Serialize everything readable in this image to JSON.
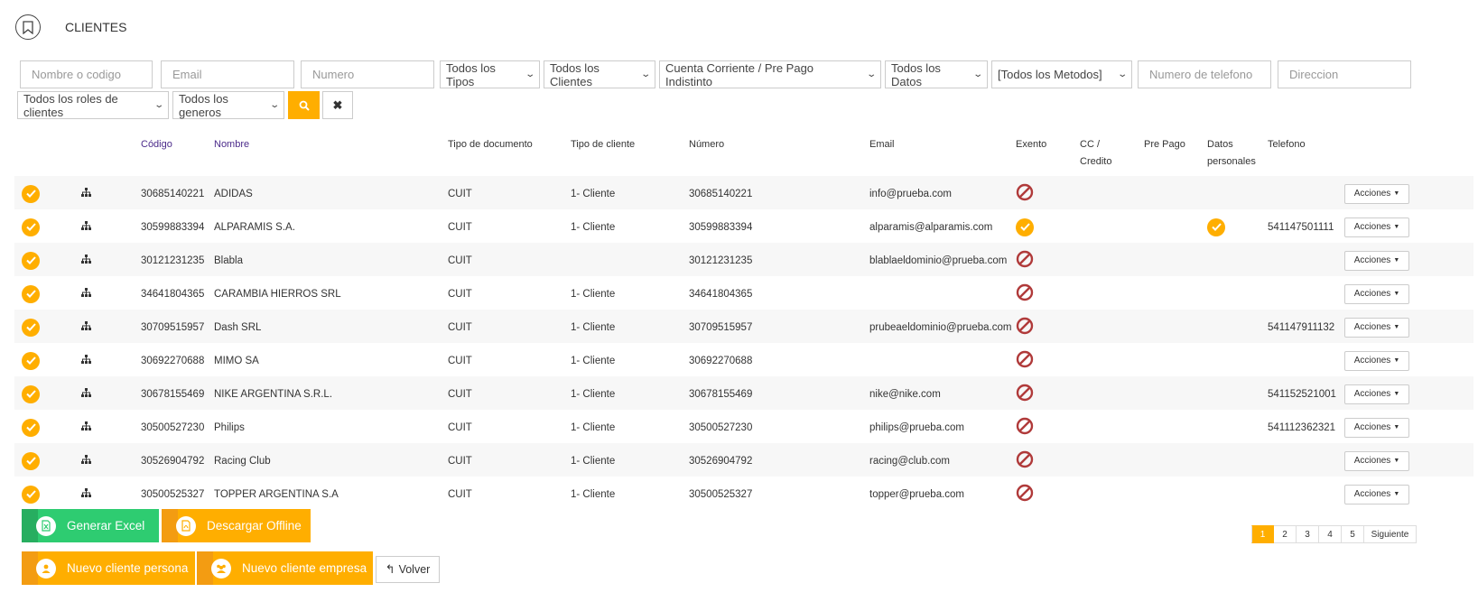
{
  "header": {
    "title": "CLIENTES"
  },
  "filters": {
    "name_placeholder": "Nombre o codigo",
    "email_placeholder": "Email",
    "number_placeholder": "Numero",
    "tipos": "Todos los Tipos",
    "clientes": "Todos los Clientes",
    "cuenta": "Cuenta Corriente / Pre Pago Indistinto",
    "datos": "Todos los Datos",
    "metodos": "[Todos los Metodos]",
    "telefono_placeholder": "Numero de telefono",
    "direccion_placeholder": "Direccion",
    "roles": "Todos los roles de clientes",
    "generos": "Todos los generos"
  },
  "table": {
    "headers": {
      "codigo": "Código",
      "nombre": "Nombre",
      "tipo_doc": "Tipo de documento",
      "tipo_cliente": "Tipo de cliente",
      "numero": "Número",
      "email": "Email",
      "exento": "Exento",
      "cc_line1": "CC /",
      "cc_line2": "Credito",
      "prepago": "Pre Pago",
      "datos_line1": "Datos",
      "datos_line2": "personales",
      "telefono": "Telefono"
    },
    "action_label": "Acciones",
    "rows": [
      {
        "codigo": "30685140221",
        "nombre": "ADIDAS",
        "tipo_doc": "CUIT",
        "tipo_cliente": "1- Cliente",
        "numero": "30685140221",
        "email": "info@prueba.com",
        "exento": false,
        "datos": false,
        "telefono": ""
      },
      {
        "codigo": "30599883394",
        "nombre": "ALPARAMIS S.A.",
        "tipo_doc": "CUIT",
        "tipo_cliente": "1- Cliente",
        "numero": "30599883394",
        "email": "alparamis@alparamis.com",
        "exento": true,
        "datos": true,
        "telefono": "541147501111"
      },
      {
        "codigo": "30121231235",
        "nombre": "Blabla",
        "tipo_doc": "CUIT",
        "tipo_cliente": "",
        "numero": "30121231235",
        "email": "blablaeldominio@prueba.com",
        "exento": false,
        "datos": false,
        "telefono": ""
      },
      {
        "codigo": "34641804365",
        "nombre": "CARAMBIA HIERROS SRL",
        "tipo_doc": "CUIT",
        "tipo_cliente": "1- Cliente",
        "numero": "34641804365",
        "email": "",
        "exento": false,
        "datos": false,
        "telefono": ""
      },
      {
        "codigo": "30709515957",
        "nombre": "Dash SRL",
        "tipo_doc": "CUIT",
        "tipo_cliente": "1- Cliente",
        "numero": "30709515957",
        "email": "prubeaeldominio@prueba.com",
        "exento": false,
        "datos": false,
        "telefono": "541147911132"
      },
      {
        "codigo": "30692270688",
        "nombre": "MIMO SA",
        "tipo_doc": "CUIT",
        "tipo_cliente": "1- Cliente",
        "numero": "30692270688",
        "email": "",
        "exento": false,
        "datos": false,
        "telefono": ""
      },
      {
        "codigo": "30678155469",
        "nombre": "NIKE ARGENTINA S.R.L.",
        "tipo_doc": "CUIT",
        "tipo_cliente": "1- Cliente",
        "numero": "30678155469",
        "email": "nike@nike.com",
        "exento": false,
        "datos": false,
        "telefono": "541152521001"
      },
      {
        "codigo": "30500527230",
        "nombre": "Philips",
        "tipo_doc": "CUIT",
        "tipo_cliente": "1- Cliente",
        "numero": "30500527230",
        "email": "philips@prueba.com",
        "exento": false,
        "datos": false,
        "telefono": "541112362321"
      },
      {
        "codigo": "30526904792",
        "nombre": "Racing Club",
        "tipo_doc": "CUIT",
        "tipo_cliente": "1- Cliente",
        "numero": "30526904792",
        "email": "racing@club.com",
        "exento": false,
        "datos": false,
        "telefono": ""
      },
      {
        "codigo": "30500525327",
        "nombre": "TOPPER ARGENTINA S.A",
        "tipo_doc": "CUIT",
        "tipo_cliente": "1- Cliente",
        "numero": "30500525327",
        "email": "topper@prueba.com",
        "exento": false,
        "datos": false,
        "telefono": ""
      }
    ]
  },
  "buttons": {
    "excel": "Generar Excel",
    "offline": "Descargar Offline",
    "persona": "Nuevo cliente persona",
    "empresa": "Nuevo cliente empresa",
    "volver": "Volver"
  },
  "pagination": {
    "pages": [
      "1",
      "2",
      "3",
      "4",
      "5"
    ],
    "current": "1",
    "next": "Siguiente"
  },
  "colors": {
    "accent": "#ffae00",
    "green": "#2ecc71",
    "exempt_no": "#b03a3a",
    "header_purple": "#4b2a8a"
  }
}
